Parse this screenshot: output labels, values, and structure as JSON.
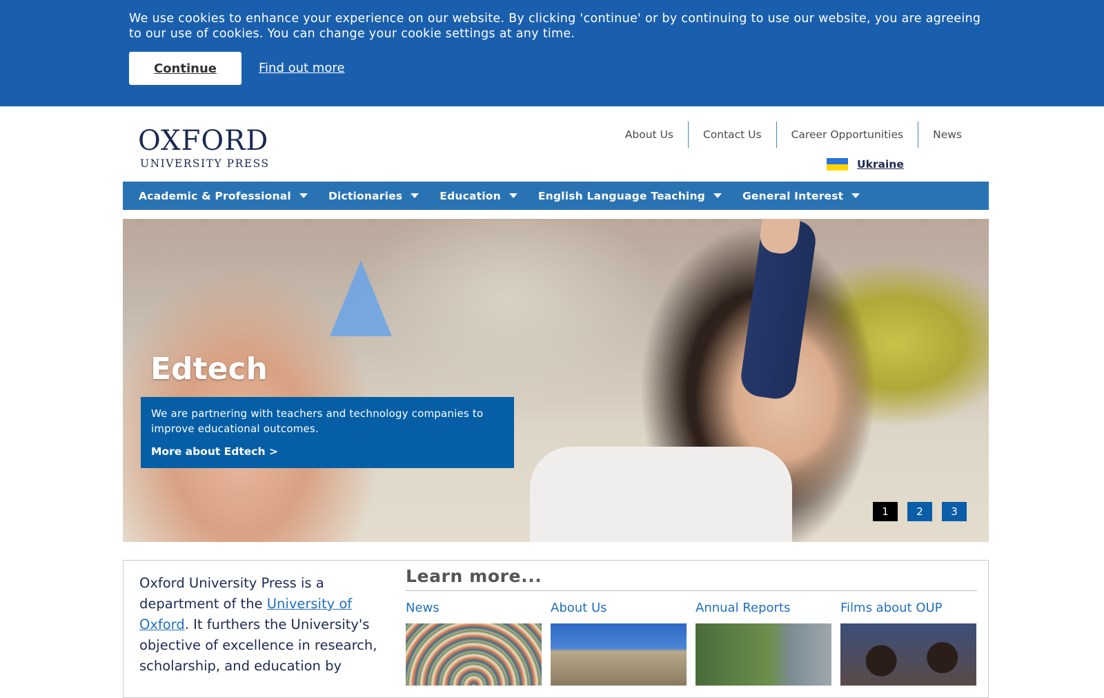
{
  "cookie_banner": {
    "text": "We use cookies to enhance your experience on our website. By clicking 'continue' or by continuing to use our website, you are agreeing to our use of cookies. You can change your cookie settings at any time.",
    "continue_label": "Continue",
    "find_out_more_label": "Find out more"
  },
  "header": {
    "logo_main": "OXFORD",
    "logo_sub": "UNIVERSITY PRESS",
    "top_links": [
      "About Us",
      "Contact Us",
      "Career Opportunities",
      "News"
    ],
    "ukraine_label": "Ukraine"
  },
  "main_nav": {
    "items": [
      "Academic & Professional",
      "Dictionaries",
      "Education",
      "English Language Teaching",
      "General Interest"
    ]
  },
  "hero": {
    "title": "Edtech",
    "description": "We are partnering with teachers and technology companies to improve educational outcomes.",
    "cta": "More about Edtech >",
    "pages": [
      "1",
      "2",
      "3"
    ],
    "active_page": 1
  },
  "intro": {
    "text_before": "Oxford University Press is a department of the ",
    "link": "University of Oxford",
    "text_after": ". It furthers the University's objective of excellence in research, scholarship, and education by"
  },
  "learn_more": {
    "title": "Learn more...",
    "items": [
      "News",
      "About Us",
      "Annual Reports",
      "Films about OUP"
    ]
  },
  "colors": {
    "cookie_bg": "#1a5fad",
    "nav_bg": "#2a73b3",
    "hero_box_bg": "#065fa6",
    "link_blue": "#1f6fc0",
    "logo_navy": "#1c2a52"
  }
}
